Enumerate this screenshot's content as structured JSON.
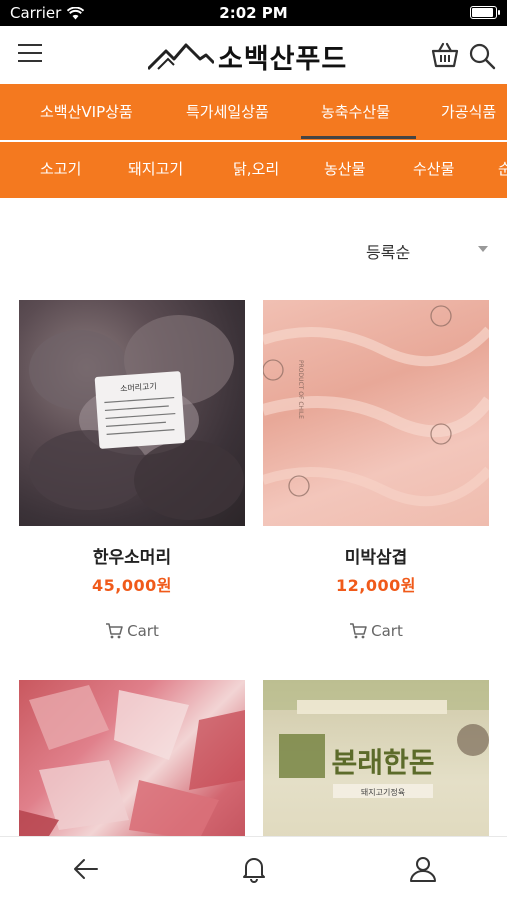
{
  "status": {
    "carrier": "Carrier",
    "time": "2:02 PM",
    "battery_level": 0.92
  },
  "header": {
    "logo_text": "소백산푸드"
  },
  "nav_primary": [
    {
      "label": "소백산VIP상품",
      "active": false
    },
    {
      "label": "특가세일상품",
      "active": false
    },
    {
      "label": "농축수산물",
      "active": true
    },
    {
      "label": "가공식품",
      "active": false
    }
  ],
  "nav_secondary": [
    {
      "label": "소고기"
    },
    {
      "label": "돼지고기"
    },
    {
      "label": "닭,오리"
    },
    {
      "label": "농산물"
    },
    {
      "label": "수산물"
    },
    {
      "label": "순"
    }
  ],
  "sort": {
    "label": "등록순"
  },
  "products": [
    {
      "name": "한우소머리",
      "price": "45,000원",
      "cart_label": "Cart"
    },
    {
      "name": "미박삼겹",
      "price": "12,000원",
      "cart_label": "Cart"
    },
    {
      "name": "",
      "price": "",
      "cart_label": ""
    },
    {
      "name": "",
      "price": "",
      "cart_label": ""
    }
  ],
  "product_images": {
    "p1_label": "소머리고기",
    "p2_stamp": "PRODUCT OF CHILE",
    "p4_brand": "본래한돈",
    "p4_small": "돼지고기정육"
  },
  "colors": {
    "accent": "#f4791f",
    "price": "#f05a1a",
    "active_underline": "#444444"
  },
  "icons": {
    "menu": "hamburger-icon",
    "basket": "basket-icon",
    "search": "search-icon",
    "cart": "cart-icon",
    "back": "arrow-left-icon",
    "bell": "bell-icon",
    "user": "user-icon"
  }
}
